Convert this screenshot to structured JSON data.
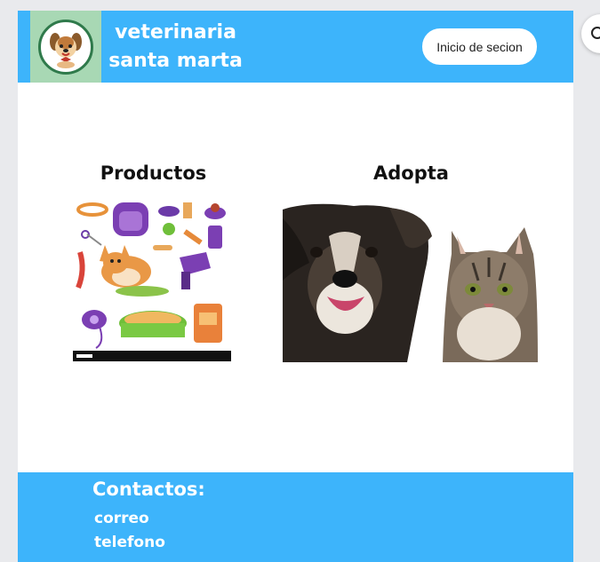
{
  "header": {
    "brand_line1": "veterinaria",
    "brand_line2": "santa marta",
    "login_label": "Inicio de secion",
    "logo_icon": "dog-logo-icon"
  },
  "main": {
    "products_title": "Productos",
    "adopt_title": "Adopta"
  },
  "footer": {
    "title": "Contactos:",
    "email_label": "correo",
    "phone_label": "telefono"
  },
  "colors": {
    "accent": "#3db4fb",
    "logo_bg": "#a8d8b4",
    "page_bg": "#e9eaed"
  },
  "side_widget": {
    "icon": "search-icon"
  }
}
